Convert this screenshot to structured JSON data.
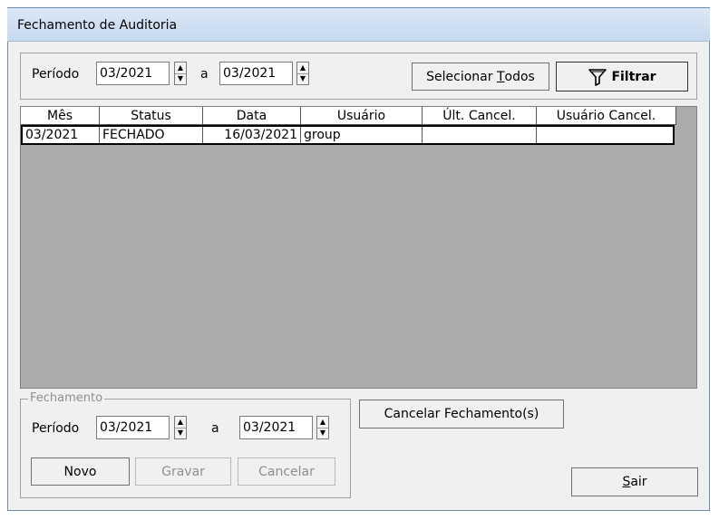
{
  "window": {
    "title": "Fechamento de Auditoria"
  },
  "filter": {
    "periodo_label": "Período",
    "from_value": "03/2021",
    "a_label": "a",
    "to_value": "03/2021",
    "select_all_prefix": "Selecionar ",
    "select_all_hotkey": "T",
    "select_all_suffix": "odos",
    "filter_label": "Filtrar",
    "filter_icon": "funnel-icon"
  },
  "grid": {
    "columns": [
      "Mês",
      "Status",
      "Data",
      "Usuário",
      "Últ. Cancel.",
      "Usuário Cancel."
    ],
    "rows": [
      {
        "mes": "03/2021",
        "status": "FECHADO",
        "data": "16/03/2021",
        "usuario": "group",
        "ult_cancel": "",
        "usuario_cancel": ""
      }
    ]
  },
  "fechamento": {
    "legend": "Fechamento",
    "periodo_label": "Período",
    "from_value": "03/2021",
    "a_label": "a",
    "to_value": "03/2021",
    "novo_label": "Novo",
    "gravar_label": "Gravar",
    "cancelar_label": "Cancelar"
  },
  "actions": {
    "cancelar_fechamentos_label": "Cancelar Fechamento(s)",
    "sair_hotkey": "S",
    "sair_suffix": "air"
  }
}
